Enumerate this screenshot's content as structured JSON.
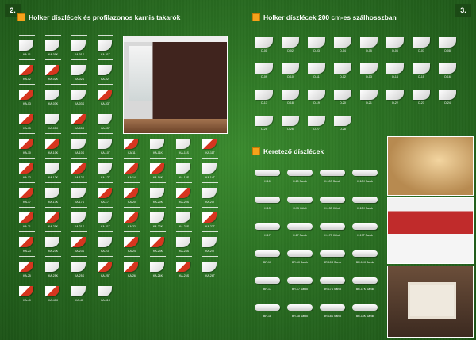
{
  "pages": {
    "left": "2.",
    "right": "3."
  },
  "left_section": {
    "title": "Holker díszlécek és profilazonos karnis takarók"
  },
  "right_section": {
    "title": "Holker díszlécek 200 cm-es szálhosszban"
  },
  "frame_section": {
    "title": "Keretező díszlécek"
  },
  "left_codes": [
    "KA-01",
    "KA-01K",
    "KA-01S",
    "KA-01T",
    "KA-02",
    "KA-02K",
    "KA-02S",
    "KA-02T",
    "KA-03",
    "KA-03K",
    "KA-03S",
    "KA-03T",
    "KA-05",
    "KA-05K",
    "KA-05S",
    "KA-05T",
    "KA-10",
    "KA-10K",
    "KA-10S",
    "KA-10T",
    "KA-11",
    "KA-11K",
    "KA-11S",
    "KA-11T",
    "KA-12",
    "KA-12K",
    "KA-12S",
    "KA-12T",
    "KA-14",
    "KA-14K",
    "KA-14S",
    "KA-14T",
    "KA-17",
    "KA-17K",
    "KA-17S",
    "KA-17T",
    "KA-20",
    "KA-20K",
    "KA-20S",
    "KA-20T",
    "KA-21",
    "KA-21K",
    "KA-21S",
    "KA-21T",
    "KA-22",
    "KA-22K",
    "KA-22S",
    "KA-22T",
    "KA-23",
    "KA-23K",
    "KA-23S",
    "KA-23T",
    "KA-24",
    "KA-24K",
    "KA-24S",
    "KA-24T",
    "KA-25",
    "KA-25K",
    "KA-25S",
    "KA-25T",
    "KA-26",
    "KA-26K",
    "KA-26S",
    "KA-26T",
    "KA-40",
    "KA-40K",
    "KA-41",
    "KA-41K"
  ],
  "right_codes": [
    "D-01",
    "D-02",
    "D-03",
    "D-04",
    "D-05",
    "D-06",
    "D-07",
    "D-08",
    "D-09",
    "D-10",
    "D-11",
    "D-12",
    "D-13",
    "D-14",
    "D-15",
    "D-16",
    "D-17",
    "D-18",
    "D-19",
    "D-20",
    "D-21",
    "D-22",
    "D-23",
    "D-24",
    "D-25",
    "D-26",
    "D-27",
    "D-28"
  ],
  "frame_codes": [
    "K-10",
    "K-10 Sarok",
    "K-10S Sarok",
    "K-10K Sarok",
    "K-13",
    "K-13 Külső",
    "K-13S Külső",
    "K-13K Sarok",
    "K-17",
    "K-17 Sarok",
    "K-17S Külső",
    "K-17T Sarok",
    "BR-10",
    "BR-10 Sarok",
    "BR-10S Sarok",
    "BR-10K Sarok",
    "BR-17",
    "BR-17 Sarok",
    "BR-17S Sarok",
    "BR-17K Sarok",
    "BR-18",
    "BR-18 Sarok",
    "BR-18S Sarok",
    "BR-18K Sarok"
  ],
  "colors": {
    "bg": "#2b7023",
    "accent": "#f5a21b",
    "red": "#d6351f"
  }
}
